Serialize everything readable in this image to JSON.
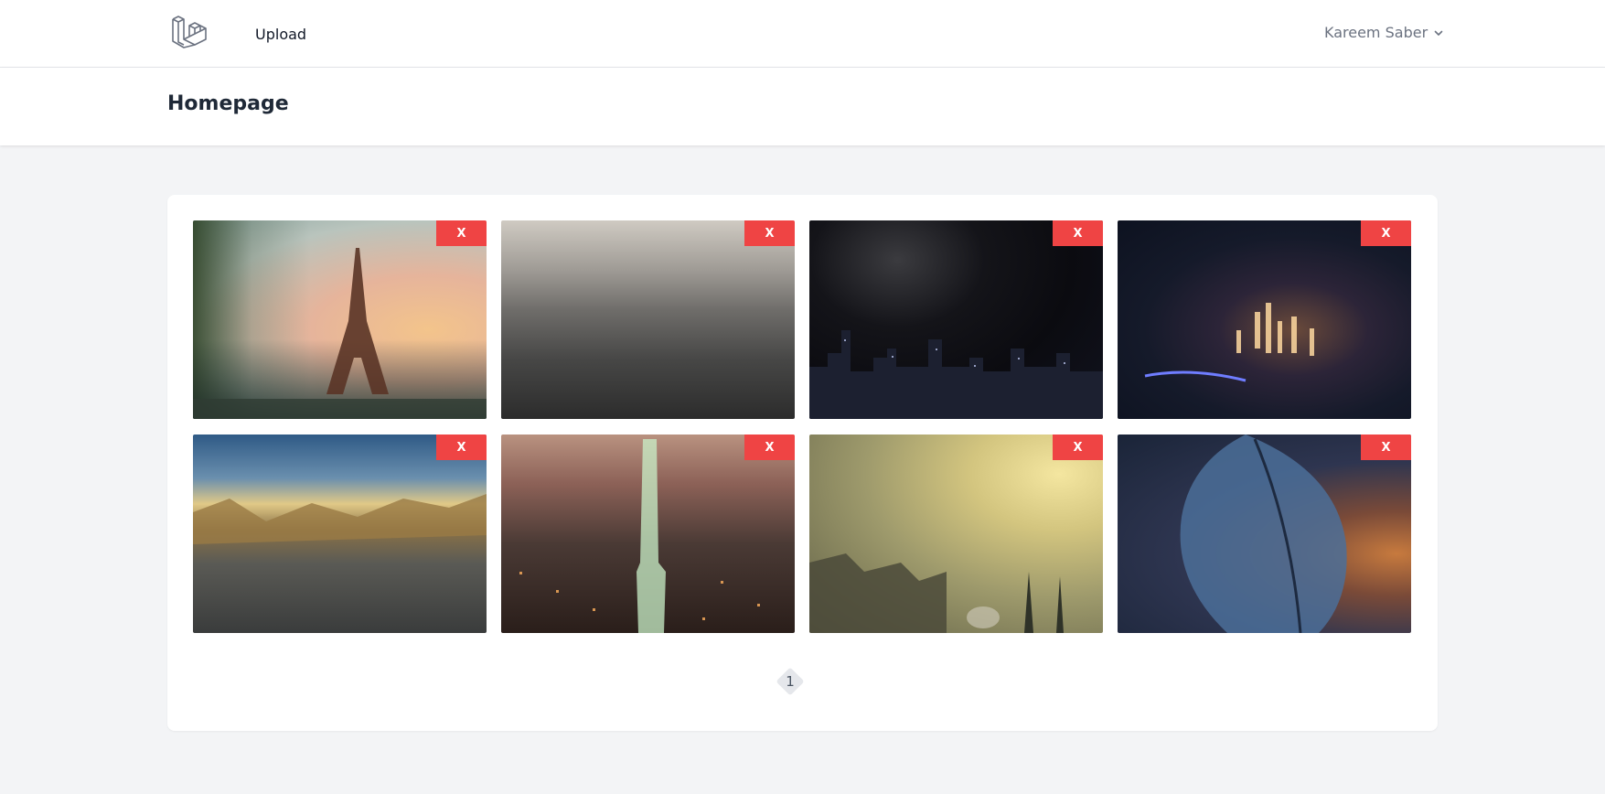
{
  "nav": {
    "upload_label": "Upload",
    "user_name": "Kareem Saber"
  },
  "header": {
    "title": "Homepage"
  },
  "gallery": {
    "delete_label": "X",
    "images": [
      {
        "subject": "Eiffel Tower at sunset"
      },
      {
        "subject": "Misty city aerial in black and white"
      },
      {
        "subject": "City skyline at night"
      },
      {
        "subject": "Illuminated city at night from above"
      },
      {
        "subject": "Mountain valley with fog"
      },
      {
        "subject": "Glowing skyscraper over night city"
      },
      {
        "subject": "Fantasy harbor city at dusk"
      },
      {
        "subject": "Blue leaf close-up"
      }
    ]
  },
  "pagination": {
    "current_page": "1"
  },
  "colors": {
    "delete_button": "#ef4444",
    "background": "#f3f4f6"
  }
}
